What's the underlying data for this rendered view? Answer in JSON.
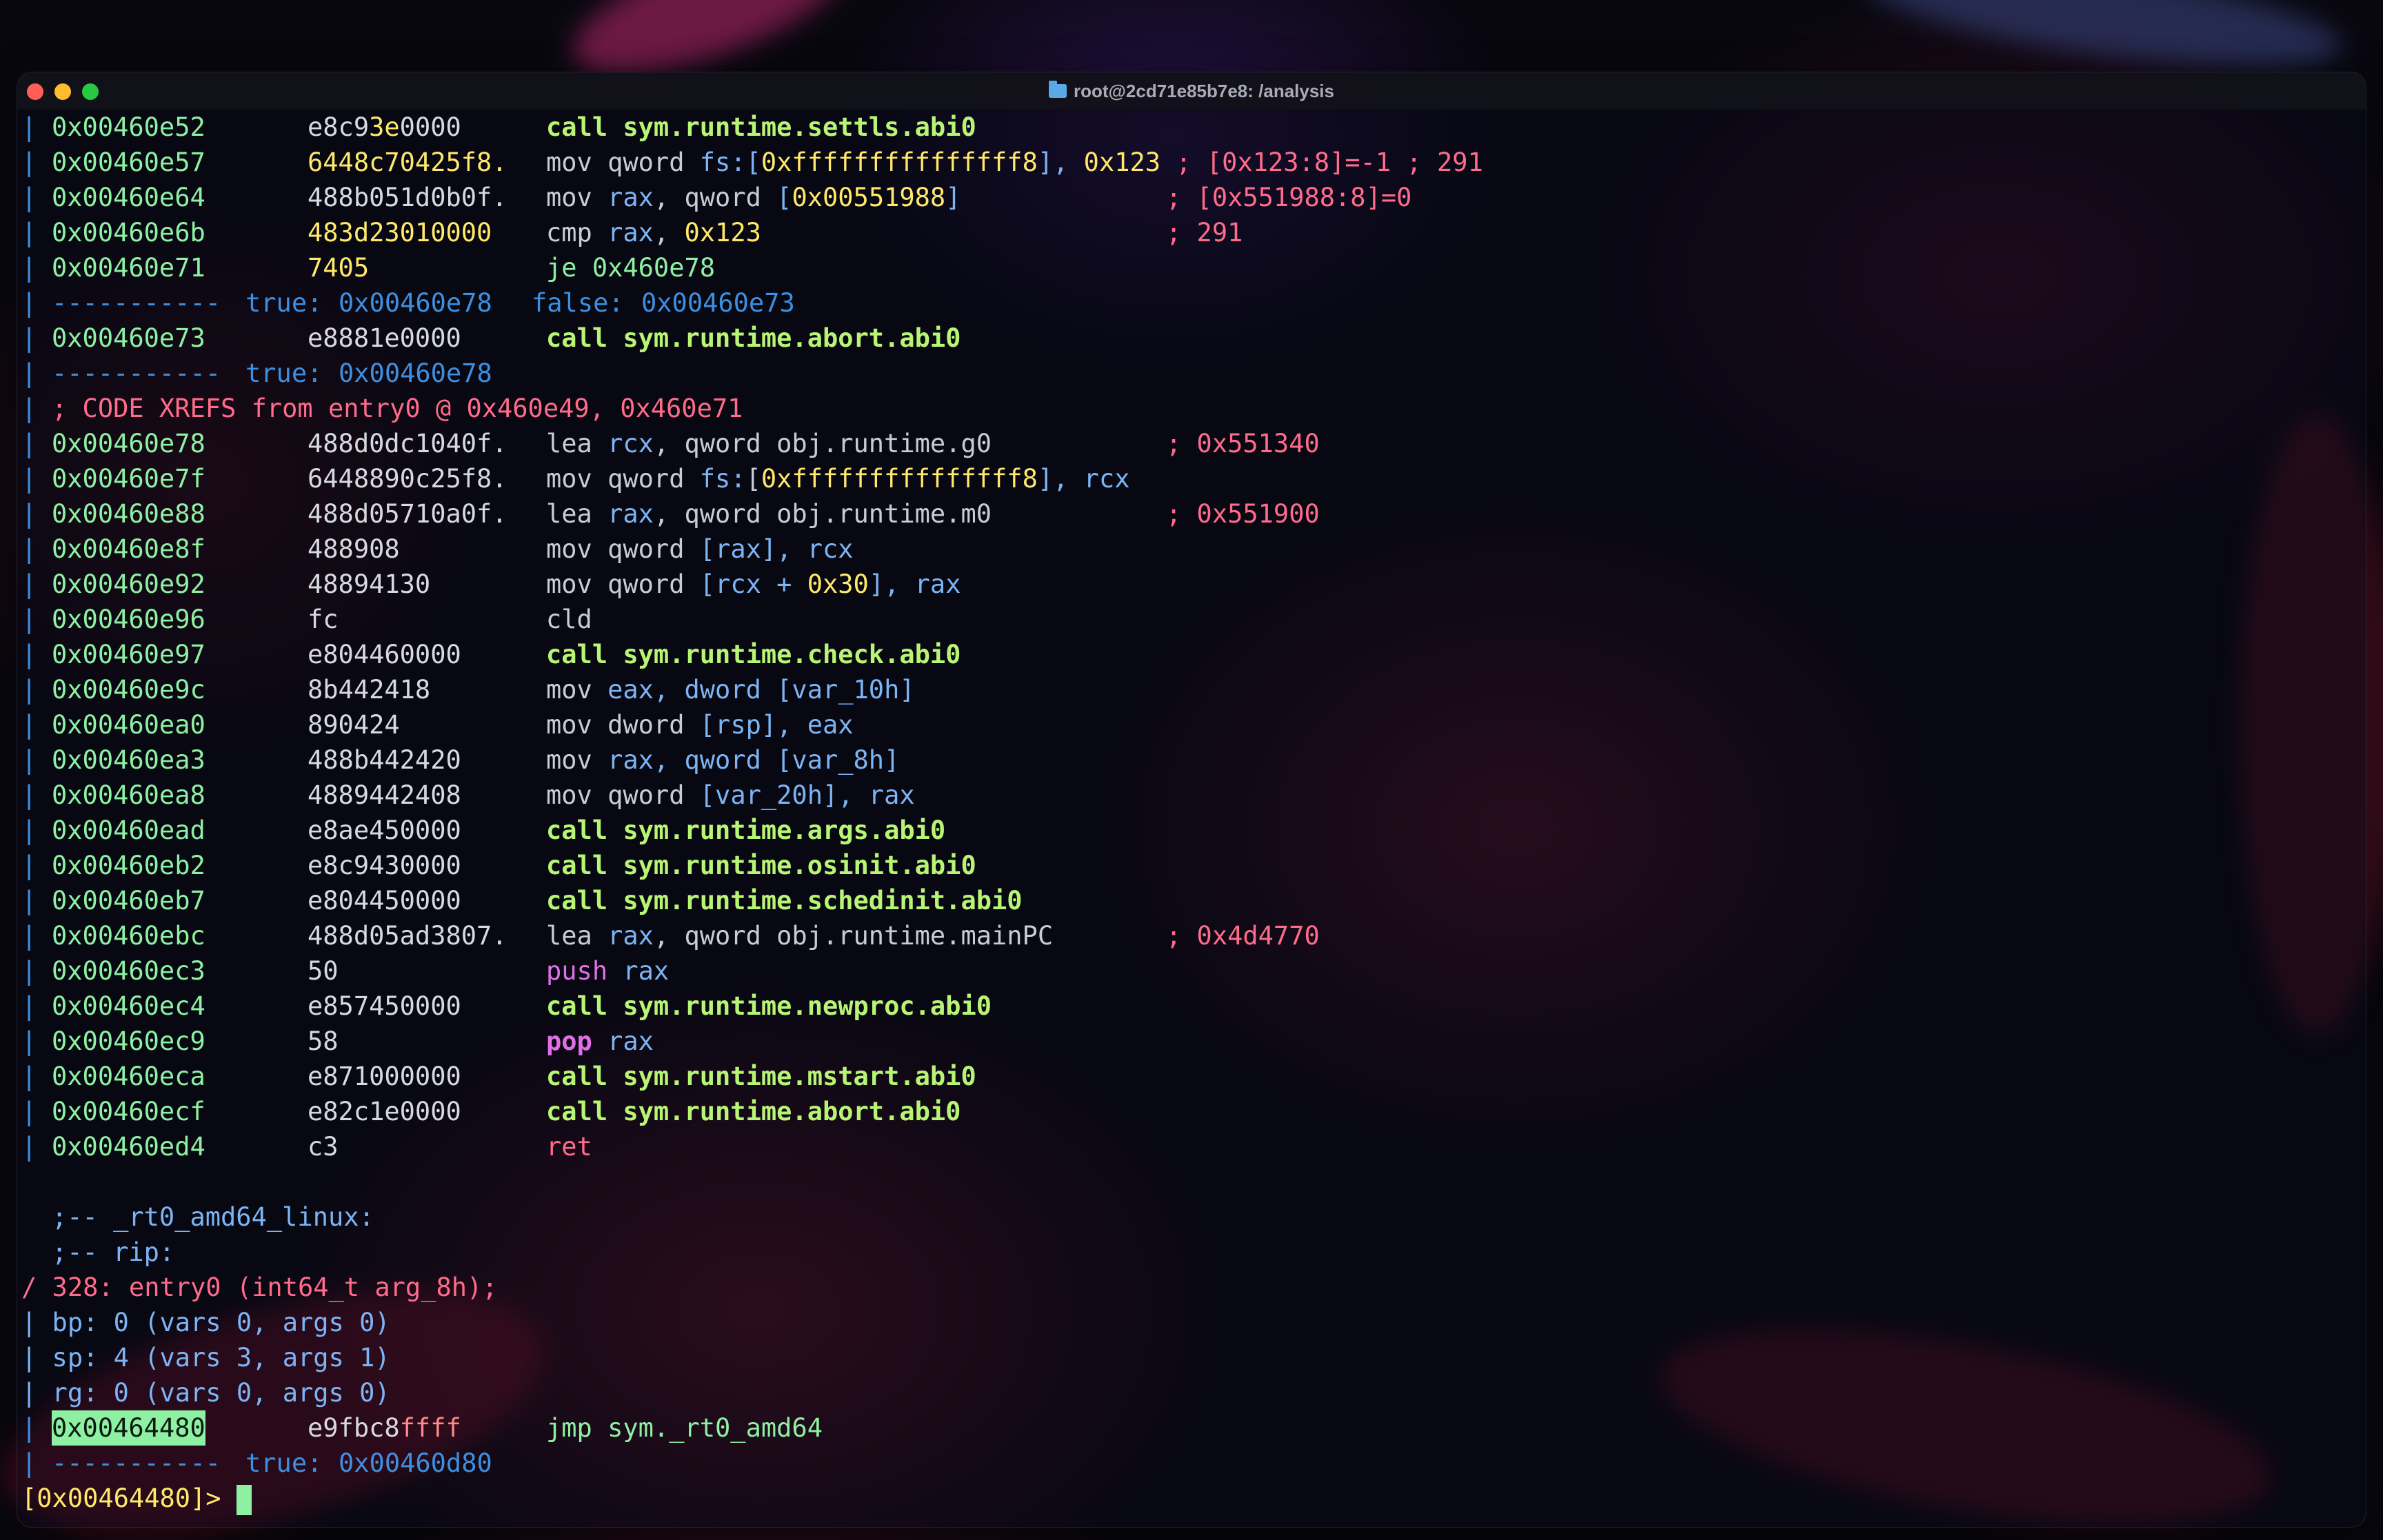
{
  "window": {
    "title": "root@2cd71e85b7e8: /analysis",
    "folder_icon": "folder-icon"
  },
  "colors": {
    "address": "#8ef0a2",
    "call": "#b8f575",
    "comment": "#ff6b8a",
    "register": "#7cb4f4",
    "number": "#ffe86a",
    "flow": "#3e8fe0"
  },
  "disasm": [
    {
      "addr": "0x00460e52",
      "bytes_a": "e8c9",
      "bytes_b": "3e",
      "bytes_c": "0000",
      "mn": "call sym.runtime.settls.abi0",
      "kind": "call"
    },
    {
      "addr": "0x00460e57",
      "bytes_a": "6448c70425f8.",
      "mn_a": "mov qword ",
      "mn_reg": "fs:",
      "mn_b": "[",
      "mn_num": "0xfffffffffffffff8",
      "mn_c": "], ",
      "mn_num2": "0x123",
      "comment": " ; [0x123:8]=-1 ; 291",
      "kind": "mov_fs"
    },
    {
      "addr": "0x00460e64",
      "bytes_a": "488b051d0b0f.",
      "mn_a": "mov ",
      "mn_reg": "rax",
      "mn_b": ", qword ",
      "mn_c": "[",
      "mn_num": "0x00551988",
      "mn_d": "]",
      "comment": "; [0x551988:8]=0",
      "kind": "mov_mem"
    },
    {
      "addr": "0x00460e6b",
      "bytes_a": "483d23010000",
      "mn_a": "cmp ",
      "mn_reg": "rax",
      "mn_b": ", ",
      "mn_num": "0x123",
      "comment": "; 291",
      "kind": "cmp"
    },
    {
      "addr": "0x00460e71",
      "bytes_a": "7405",
      "mn": "je 0x460e78",
      "kind": "je"
    }
  ],
  "flow1": {
    "dashes": "-----------",
    "true_label": "true:",
    "true_val": "0x00460e78",
    "false_label": "false:",
    "false_val": "0x00460e73"
  },
  "abort1": {
    "addr": "0x00460e73",
    "bytes": "e8881e0000",
    "mn": "call sym.runtime.abort.abi0"
  },
  "flow2": {
    "dashes": "-----------",
    "true_label": "true:",
    "true_val": "0x00460e78"
  },
  "xref": "; CODE XREFS from entry0 @ 0x460e49, 0x460e71",
  "block": [
    {
      "addr": "0x00460e78",
      "bytes": "488d0dc1040f.",
      "mn_a": "lea ",
      "mn_reg": "rcx",
      "mn_b": ", qword obj.runtime.g0",
      "comment": "; 0x551340"
    },
    {
      "addr": "0x00460e7f",
      "bytes": "6448890c25f8.",
      "mn_a": "mov qword ",
      "mn_reg": "fs:",
      "mn_b": "[",
      "mn_num": "0xfffffffffffffff8",
      "mn_c": "], ",
      "mn_reg2": "rcx"
    },
    {
      "addr": "0x00460e88",
      "bytes": "488d05710a0f.",
      "mn_a": "lea ",
      "mn_reg": "rax",
      "mn_b": ", qword obj.runtime.m0",
      "comment": "; 0x551900"
    },
    {
      "addr": "0x00460e8f",
      "bytes": "488908",
      "mn_a": "mov qword ",
      "mn_reg": "[rax], rcx"
    },
    {
      "addr": "0x00460e92",
      "bytes": "48894130",
      "mn_a": "mov qword ",
      "mn_reg": "[rcx + ",
      "mn_num": "0x30",
      "mn_c": "], rax"
    },
    {
      "addr": "0x00460e96",
      "bytes": "fc",
      "mn_a": "cld"
    },
    {
      "addr": "0x00460e97",
      "bytes": "e804460000",
      "mn_call": "call sym.runtime.check.abi0"
    },
    {
      "addr": "0x00460e9c",
      "bytes": "8b442418",
      "mn_a": "mov ",
      "mn_reg": "eax, dword [var_10h]"
    },
    {
      "addr": "0x00460ea0",
      "bytes": "890424",
      "mn_a": "mov dword ",
      "mn_reg": "[rsp], eax"
    },
    {
      "addr": "0x00460ea3",
      "bytes": "488b442420",
      "mn_a": "mov ",
      "mn_reg": "rax, qword [var_8h]"
    },
    {
      "addr": "0x00460ea8",
      "bytes": "4889442408",
      "mn_a": "mov qword ",
      "mn_reg": "[var_20h], rax"
    },
    {
      "addr": "0x00460ead",
      "bytes": "e8ae450000",
      "mn_call": "call sym.runtime.args.abi0"
    },
    {
      "addr": "0x00460eb2",
      "bytes": "e8c9430000",
      "mn_call": "call sym.runtime.osinit.abi0"
    },
    {
      "addr": "0x00460eb7",
      "bytes": "e804450000",
      "mn_call": "call sym.runtime.schedinit.abi0"
    },
    {
      "addr": "0x00460ebc",
      "bytes": "488d05ad3807.",
      "mn_a": "lea ",
      "mn_reg": "rax",
      "mn_b": ", qword obj.runtime.mainPC",
      "comment": "; 0x4d4770"
    },
    {
      "addr": "0x00460ec3",
      "bytes": "50",
      "mn_push": "push",
      "mn_reg": " rax"
    },
    {
      "addr": "0x00460ec4",
      "bytes": "e857450000",
      "mn_call": "call sym.runtime.newproc.abi0"
    },
    {
      "addr": "0x00460ec9",
      "bytes": "58",
      "mn_pop": "pop",
      "mn_reg": " rax"
    },
    {
      "addr": "0x00460eca",
      "bytes": "e871000000",
      "mn_call": "call sym.runtime.mstart.abi0"
    },
    {
      "addr": "0x00460ecf",
      "bytes": "e82c1e0000",
      "mn_call": "call sym.runtime.abort.abi0"
    },
    {
      "addr": "0x00460ed4",
      "bytes": "c3",
      "mn_ret": "ret"
    }
  ],
  "labels": [
    ";-- _rt0_amd64_linux:",
    ";-- rip:"
  ],
  "func": {
    "header": "/ 328: entry0 (int64_t arg_8h);",
    "bp": "| bp: 0 (vars 0, args 0)",
    "sp": "| sp: 4 (vars 3, args 1)",
    "rg": "| rg: 0 (vars 0, args 0)"
  },
  "current": {
    "addr": "0x00464480",
    "bytes": "e9fbc8ffff",
    "mn": "jmp sym._rt0_amd64"
  },
  "flow3": {
    "dashes": "-----------",
    "true_label": "true:",
    "true_val": "0x00460d80"
  },
  "prompt": "[0x00464480]> "
}
